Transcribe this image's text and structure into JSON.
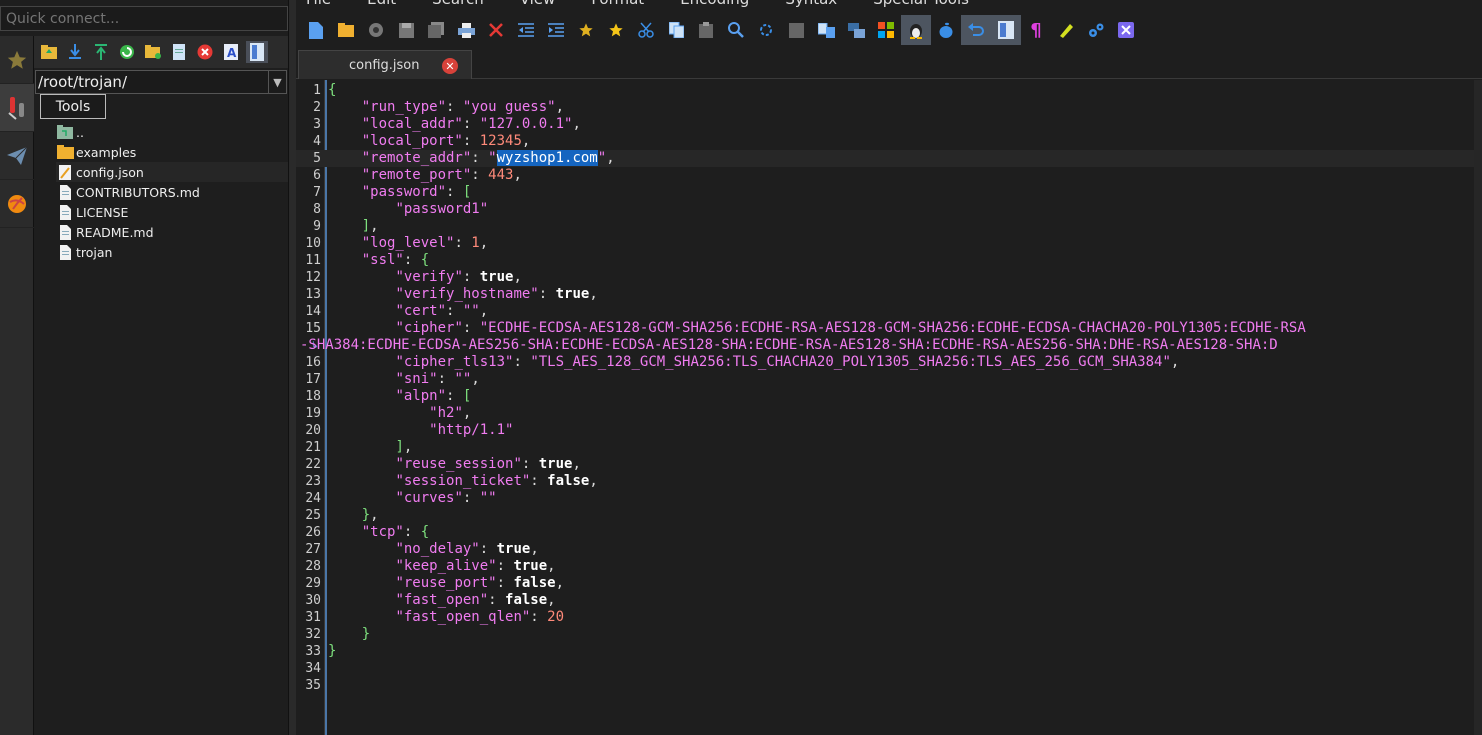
{
  "quick_connect": {
    "placeholder": "Quick connect..."
  },
  "sftp": {
    "path": "/root/trojan/",
    "tools_label": "Tools",
    "files": [
      {
        "name": "..",
        "icon": "parent-folder-icon"
      },
      {
        "name": "examples",
        "icon": "folder-icon"
      },
      {
        "name": "config.json",
        "icon": "edit-file-icon"
      },
      {
        "name": "CONTRIBUTORS.md",
        "icon": "file-icon"
      },
      {
        "name": "LICENSE",
        "icon": "file-icon"
      },
      {
        "name": "README.md",
        "icon": "file-icon"
      },
      {
        "name": "trojan",
        "icon": "file-icon"
      }
    ]
  },
  "menu": [
    "File",
    "Edit",
    "Search",
    "View",
    "Format",
    "Encoding",
    "Syntax",
    "Special Tools"
  ],
  "tab": {
    "title": "config.json"
  },
  "colors": {
    "accent": "#1565c0",
    "close": "#d8423a",
    "string": "#f07cf0",
    "number": "#ff8a7a",
    "brace": "#7ee07e"
  },
  "editor": {
    "current_line": 5,
    "lines": [
      {
        "n": "1",
        "tokens": [
          [
            "br",
            "{"
          ]
        ]
      },
      {
        "n": "2",
        "tokens": [
          [
            "p",
            "    "
          ],
          [
            "k",
            "\"run_type\""
          ],
          [
            "p",
            ": "
          ],
          [
            "s",
            "\"you guess\""
          ],
          [
            "p",
            ","
          ]
        ]
      },
      {
        "n": "3",
        "tokens": [
          [
            "p",
            "    "
          ],
          [
            "k",
            "\"local_addr\""
          ],
          [
            "p",
            ": "
          ],
          [
            "s",
            "\"127.0.0.1\""
          ],
          [
            "p",
            ","
          ]
        ]
      },
      {
        "n": "4",
        "tokens": [
          [
            "p",
            "    "
          ],
          [
            "k",
            "\"local_port\""
          ],
          [
            "p",
            ": "
          ],
          [
            "n",
            "12345"
          ],
          [
            "p",
            ","
          ]
        ]
      },
      {
        "n": "5",
        "tokens": [
          [
            "p",
            "    "
          ],
          [
            "k",
            "\"remote_addr\""
          ],
          [
            "p",
            ": "
          ],
          [
            "s",
            "\""
          ],
          [
            "hl",
            "wyzshop1.com"
          ],
          [
            "s",
            "\""
          ],
          [
            "p",
            ","
          ]
        ]
      },
      {
        "n": "6",
        "tokens": [
          [
            "p",
            "    "
          ],
          [
            "k",
            "\"remote_port\""
          ],
          [
            "p",
            ": "
          ],
          [
            "n",
            "443"
          ],
          [
            "p",
            ","
          ]
        ]
      },
      {
        "n": "7",
        "tokens": [
          [
            "p",
            "    "
          ],
          [
            "k",
            "\"password\""
          ],
          [
            "p",
            ": "
          ],
          [
            "br",
            "["
          ]
        ]
      },
      {
        "n": "8",
        "tokens": [
          [
            "p",
            "        "
          ],
          [
            "s",
            "\"password1\""
          ]
        ]
      },
      {
        "n": "9",
        "tokens": [
          [
            "p",
            "    "
          ],
          [
            "br",
            "]"
          ],
          [
            "p",
            ","
          ]
        ]
      },
      {
        "n": "10",
        "tokens": [
          [
            "p",
            "    "
          ],
          [
            "k",
            "\"log_level\""
          ],
          [
            "p",
            ": "
          ],
          [
            "n",
            "1"
          ],
          [
            "p",
            ","
          ]
        ]
      },
      {
        "n": "11",
        "tokens": [
          [
            "p",
            "    "
          ],
          [
            "k",
            "\"ssl\""
          ],
          [
            "p",
            ": "
          ],
          [
            "br",
            "{"
          ]
        ]
      },
      {
        "n": "12",
        "tokens": [
          [
            "p",
            "        "
          ],
          [
            "k",
            "\"verify\""
          ],
          [
            "p",
            ": "
          ],
          [
            "b",
            "true"
          ],
          [
            "p",
            ","
          ]
        ]
      },
      {
        "n": "13",
        "tokens": [
          [
            "p",
            "        "
          ],
          [
            "k",
            "\"verify_hostname\""
          ],
          [
            "p",
            ": "
          ],
          [
            "b",
            "true"
          ],
          [
            "p",
            ","
          ]
        ]
      },
      {
        "n": "14",
        "tokens": [
          [
            "p",
            "        "
          ],
          [
            "k",
            "\"cert\""
          ],
          [
            "p",
            ": "
          ],
          [
            "s",
            "\"\""
          ],
          [
            "p",
            ","
          ]
        ]
      },
      {
        "n": "15",
        "tokens": [
          [
            "p",
            "        "
          ],
          [
            "k",
            "\"cipher\""
          ],
          [
            "p",
            ": "
          ],
          [
            "s",
            "\"ECDHE-ECDSA-AES128-GCM-SHA256:ECDHE-RSA-AES128-GCM-SHA256:ECDHE-ECDSA-CHACHA20-POLY1305:ECDHE-RSA"
          ]
        ]
      },
      {
        "n": "",
        "wrap": true,
        "tokens": [
          [
            "s",
            "-SHA384:ECDHE-ECDSA-AES256-SHA:ECDHE-ECDSA-AES128-SHA:ECDHE-RSA-AES128-SHA:ECDHE-RSA-AES256-SHA:DHE-RSA-AES128-SHA:D"
          ]
        ]
      },
      {
        "n": "16",
        "tokens": [
          [
            "p",
            "        "
          ],
          [
            "k",
            "\"cipher_tls13\""
          ],
          [
            "p",
            ": "
          ],
          [
            "s",
            "\"TLS_AES_128_GCM_SHA256:TLS_CHACHA20_POLY1305_SHA256:TLS_AES_256_GCM_SHA384\""
          ],
          [
            "p",
            ","
          ]
        ]
      },
      {
        "n": "17",
        "tokens": [
          [
            "p",
            "        "
          ],
          [
            "k",
            "\"sni\""
          ],
          [
            "p",
            ": "
          ],
          [
            "s",
            "\"\""
          ],
          [
            "p",
            ","
          ]
        ]
      },
      {
        "n": "18",
        "tokens": [
          [
            "p",
            "        "
          ],
          [
            "k",
            "\"alpn\""
          ],
          [
            "p",
            ": "
          ],
          [
            "br",
            "["
          ]
        ]
      },
      {
        "n": "19",
        "tokens": [
          [
            "p",
            "            "
          ],
          [
            "s",
            "\"h2\""
          ],
          [
            "p",
            ","
          ]
        ]
      },
      {
        "n": "20",
        "tokens": [
          [
            "p",
            "            "
          ],
          [
            "s",
            "\"http/1.1\""
          ]
        ]
      },
      {
        "n": "21",
        "tokens": [
          [
            "p",
            "        "
          ],
          [
            "br",
            "]"
          ],
          [
            "p",
            ","
          ]
        ]
      },
      {
        "n": "22",
        "tokens": [
          [
            "p",
            "        "
          ],
          [
            "k",
            "\"reuse_session\""
          ],
          [
            "p",
            ": "
          ],
          [
            "b",
            "true"
          ],
          [
            "p",
            ","
          ]
        ]
      },
      {
        "n": "23",
        "tokens": [
          [
            "p",
            "        "
          ],
          [
            "k",
            "\"session_ticket\""
          ],
          [
            "p",
            ": "
          ],
          [
            "b",
            "false"
          ],
          [
            "p",
            ","
          ]
        ]
      },
      {
        "n": "24",
        "tokens": [
          [
            "p",
            "        "
          ],
          [
            "k",
            "\"curves\""
          ],
          [
            "p",
            ": "
          ],
          [
            "s",
            "\"\""
          ]
        ]
      },
      {
        "n": "25",
        "tokens": [
          [
            "p",
            "    "
          ],
          [
            "br",
            "}"
          ],
          [
            "p",
            ","
          ]
        ]
      },
      {
        "n": "26",
        "tokens": [
          [
            "p",
            "    "
          ],
          [
            "k",
            "\"tcp\""
          ],
          [
            "p",
            ": "
          ],
          [
            "br",
            "{"
          ]
        ]
      },
      {
        "n": "27",
        "tokens": [
          [
            "p",
            "        "
          ],
          [
            "k",
            "\"no_delay\""
          ],
          [
            "p",
            ": "
          ],
          [
            "b",
            "true"
          ],
          [
            "p",
            ","
          ]
        ]
      },
      {
        "n": "28",
        "tokens": [
          [
            "p",
            "        "
          ],
          [
            "k",
            "\"keep_alive\""
          ],
          [
            "p",
            ": "
          ],
          [
            "b",
            "true"
          ],
          [
            "p",
            ","
          ]
        ]
      },
      {
        "n": "29",
        "tokens": [
          [
            "p",
            "        "
          ],
          [
            "k",
            "\"reuse_port\""
          ],
          [
            "p",
            ": "
          ],
          [
            "b",
            "false"
          ],
          [
            "p",
            ","
          ]
        ]
      },
      {
        "n": "30",
        "tokens": [
          [
            "p",
            "        "
          ],
          [
            "k",
            "\"fast_open\""
          ],
          [
            "p",
            ": "
          ],
          [
            "b",
            "false"
          ],
          [
            "p",
            ","
          ]
        ]
      },
      {
        "n": "31",
        "tokens": [
          [
            "p",
            "        "
          ],
          [
            "k",
            "\"fast_open_qlen\""
          ],
          [
            "p",
            ": "
          ],
          [
            "n",
            "20"
          ]
        ]
      },
      {
        "n": "32",
        "tokens": [
          [
            "p",
            "    "
          ],
          [
            "br",
            "}"
          ]
        ]
      },
      {
        "n": "33",
        "tokens": [
          [
            "br",
            "}"
          ]
        ]
      },
      {
        "n": "34",
        "tokens": []
      },
      {
        "n": "35",
        "tokens": []
      }
    ]
  }
}
